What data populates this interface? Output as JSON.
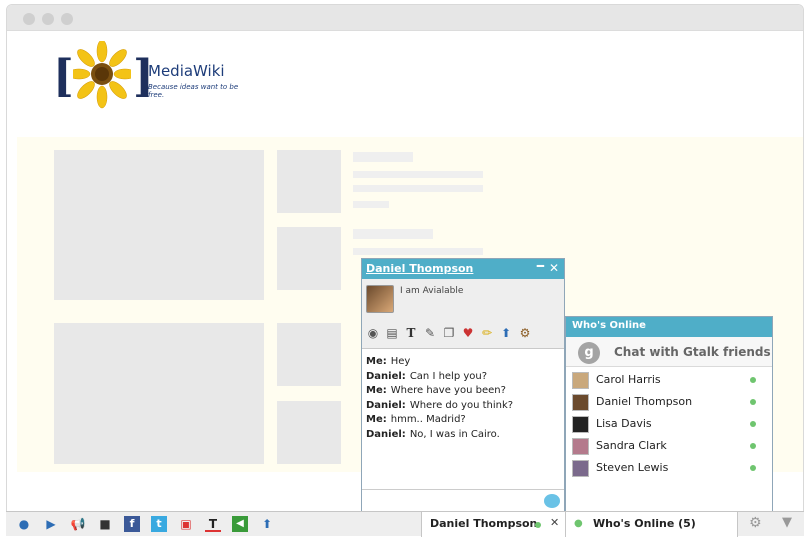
{
  "logo": {
    "name": "MediaWiki",
    "tagline": "Because ideas want to be free."
  },
  "chat": {
    "name": "Daniel Thompson",
    "status": "I am Avialable",
    "messages": [
      {
        "who": "Me:",
        "text": "Hey"
      },
      {
        "who": "Daniel:",
        "text": "Can I help you?"
      },
      {
        "who": "Me:",
        "text": "Where have you been?"
      },
      {
        "who": "Daniel:",
        "text": "Where do you think?"
      },
      {
        "who": "Me:",
        "text": "hmm.. Madrid?"
      },
      {
        "who": "Daniel:",
        "text": "No, I was in Cairo."
      }
    ]
  },
  "online": {
    "title": "Who's Online",
    "gtalk_label": "Chat with Gtalk friends",
    "friends": [
      {
        "name": "Carol Harris",
        "color": "#c9a87c"
      },
      {
        "name": "Daniel Thompson",
        "color": "#6b4a2d"
      },
      {
        "name": "Lisa Davis",
        "color": "#222222"
      },
      {
        "name": "Sandra Clark",
        "color": "#b47a8c"
      },
      {
        "name": "Steven Lewis",
        "color": "#7b6a8c"
      }
    ]
  },
  "bottombar": {
    "chat_tab": "Daniel Thompson",
    "online_tab": "Who's Online (5)"
  },
  "colors": {
    "accent": "#4faec8",
    "status_online": "#6fc56f"
  }
}
